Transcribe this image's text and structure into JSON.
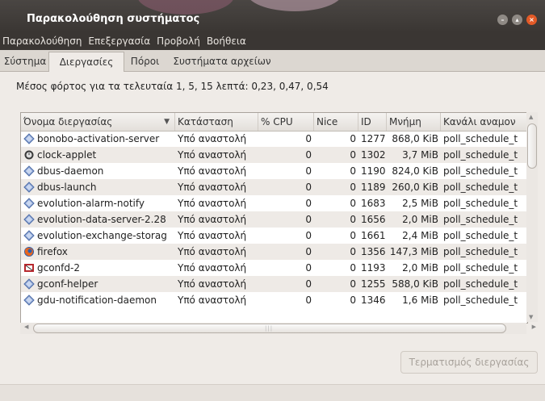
{
  "window": {
    "title": "Παρακολούθηση συστήματος"
  },
  "menu": [
    "Παρακολούθηση",
    "Επεξεργασία",
    "Προβολή",
    "Βοήθεια"
  ],
  "tabs": [
    "Σύστημα",
    "Διεργασίες",
    "Πόροι",
    "Συστήματα αρχείων"
  ],
  "active_tab": "Διεργασίες",
  "load_text": "Μέσος φόρτος για τα τελευταία 1, 5, 15 λεπτά: 0,23, 0,47, 0,54",
  "columns": [
    "Όνομα διεργασίας",
    "Κατάσταση",
    "% CPU",
    "Nice",
    "ID",
    "Μνήμη",
    "Κανάλι αναμον"
  ],
  "rows": [
    {
      "name": "bonobo-activation-server",
      "state": "Υπό αναστολή",
      "cpu": "0",
      "nice": "0",
      "id": "1277",
      "mem": "868,0 KiB",
      "chan": "poll_schedule_t",
      "icon": "diamond-icon"
    },
    {
      "name": "clock-applet",
      "state": "Υπό αναστολή",
      "cpu": "0",
      "nice": "0",
      "id": "1302",
      "mem": "3,7 MiB",
      "chan": "poll_schedule_t",
      "icon": "clock-icon"
    },
    {
      "name": "dbus-daemon",
      "state": "Υπό αναστολή",
      "cpu": "0",
      "nice": "0",
      "id": "1190",
      "mem": "824,0 KiB",
      "chan": "poll_schedule_t",
      "icon": "diamond-icon"
    },
    {
      "name": "dbus-launch",
      "state": "Υπό αναστολή",
      "cpu": "0",
      "nice": "0",
      "id": "1189",
      "mem": "260,0 KiB",
      "chan": "poll_schedule_t",
      "icon": "diamond-icon"
    },
    {
      "name": "evolution-alarm-notify",
      "state": "Υπό αναστολή",
      "cpu": "0",
      "nice": "0",
      "id": "1683",
      "mem": "2,5 MiB",
      "chan": "poll_schedule_t",
      "icon": "diamond-icon"
    },
    {
      "name": "evolution-data-server-2.28",
      "state": "Υπό αναστολή",
      "cpu": "0",
      "nice": "0",
      "id": "1656",
      "mem": "2,0 MiB",
      "chan": "poll_schedule_t",
      "icon": "diamond-icon"
    },
    {
      "name": "evolution-exchange-storag",
      "state": "Υπό αναστολή",
      "cpu": "0",
      "nice": "0",
      "id": "1661",
      "mem": "2,4 MiB",
      "chan": "poll_schedule_t",
      "icon": "diamond-icon"
    },
    {
      "name": "firefox",
      "state": "Υπό αναστολή",
      "cpu": "0",
      "nice": "0",
      "id": "1356",
      "mem": "147,3 MiB",
      "chan": "poll_schedule_t",
      "icon": "firefox-icon"
    },
    {
      "name": "gconfd-2",
      "state": "Υπό αναστολή",
      "cpu": "0",
      "nice": "0",
      "id": "1193",
      "mem": "2,0 MiB",
      "chan": "poll_schedule_t",
      "icon": "gconf-icon"
    },
    {
      "name": "gconf-helper",
      "state": "Υπό αναστολή",
      "cpu": "0",
      "nice": "0",
      "id": "1255",
      "mem": "588,0 KiB",
      "chan": "poll_schedule_t",
      "icon": "diamond-icon"
    },
    {
      "name": "gdu-notification-daemon",
      "state": "Υπό αναστολή",
      "cpu": "0",
      "nice": "0",
      "id": "1346",
      "mem": "1,6 MiB",
      "chan": "poll_schedule_t",
      "icon": "diamond-icon"
    }
  ],
  "end_button": "Τερματισμός διεργασίας",
  "colors": {
    "accent_close": "#e35a27",
    "titlebar": "#3a3633",
    "alt_row": "#eeeae6"
  }
}
